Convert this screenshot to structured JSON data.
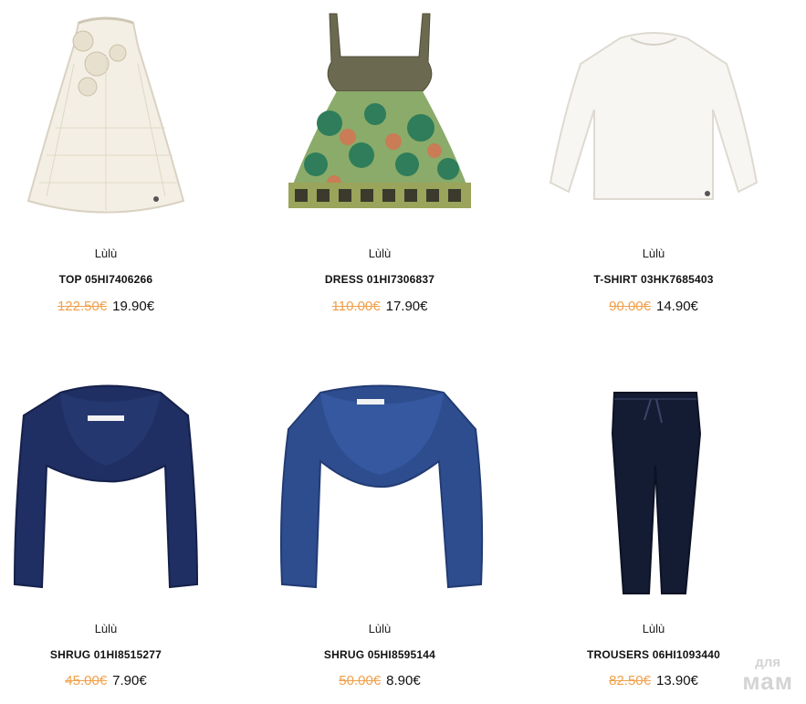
{
  "products": [
    {
      "brand": "Lùlù",
      "name": "TOP 05HI7406266",
      "old_price": "122.50€",
      "new_price": "19.90€",
      "image": "white-lace-top"
    },
    {
      "brand": "Lùlù",
      "name": "DRESS 01HI7306837",
      "old_price": "110.00€",
      "new_price": "17.90€",
      "image": "patterned-dress"
    },
    {
      "brand": "Lùlù",
      "name": "T-SHIRT 03HK7685403",
      "old_price": "90.00€",
      "new_price": "14.90€",
      "image": "white-longsleeve-tshirt"
    },
    {
      "brand": "Lùlù",
      "name": "SHRUG 01HI8515277",
      "old_price": "45.00€",
      "new_price": "7.90€",
      "image": "navy-shrug"
    },
    {
      "brand": "Lùlù",
      "name": "SHRUG 05HI8595144",
      "old_price": "50.00€",
      "new_price": "8.90€",
      "image": "blue-shrug"
    },
    {
      "brand": "Lùlù",
      "name": "TROUSERS 06HI1093440",
      "old_price": "82.50€",
      "new_price": "13.90€",
      "image": "navy-trousers"
    }
  ],
  "watermark": {
    "top": "для",
    "bottom": "мам"
  },
  "colors": {
    "old_price": "#f0a04b",
    "text": "#111111",
    "navy": "#1f2f63",
    "blue": "#2e4d8f"
  }
}
